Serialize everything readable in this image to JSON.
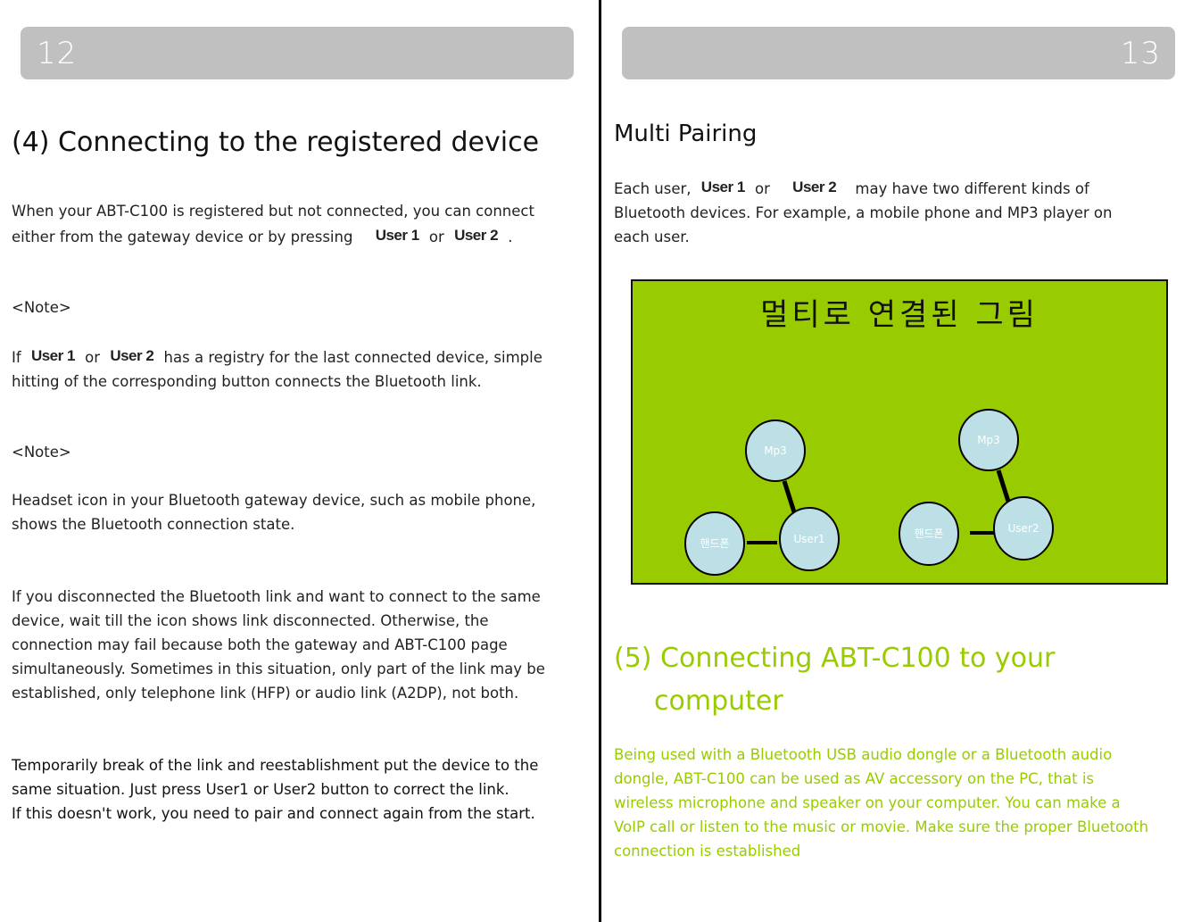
{
  "left_page": {
    "page_number": "12",
    "heading": "(4) Connecting to the registered device",
    "intro": {
      "text_before": "When your ABT-C100 is registered but not connected, you can connect",
      "text_line2": "either from the gateway device or by pressing",
      "badge1": "User 1",
      "or": "or",
      "badge2": "User 2",
      "end": "."
    },
    "note1_label": "<Note>",
    "note1": {
      "prefix": "If",
      "badge1": "User 1",
      "or": "or",
      "badge2": "User 2",
      "text_line1": "has a registry for the last connected device, simple",
      "text_line2": "hitting of the corresponding button connects the Bluetooth link."
    },
    "note2_label": "<Note>",
    "note2_lines": [
      "Headset icon in your Bluetooth gateway device, such as mobile phone,",
      "shows the Bluetooth connection state."
    ],
    "disconnect_lines": [
      "If you disconnected the Bluetooth link and want to connect to the same",
      "device, wait till the icon shows link disconnected. Otherwise, the",
      "connection may fail because both the gateway and ABT-C100 page",
      "simultaneously. Sometimes in this situation, only part of the link may be",
      "established, only telephone link (HFP) or audio link (A2DP), not both."
    ],
    "temporary_lines": [
      "Temporarily break of the link and reestablishment put the device to the",
      "same situation. Just press User1 or User2 button to correct the link.",
      "If this doesn't work, you need to pair and connect again from the start."
    ]
  },
  "right_page": {
    "page_number": "13",
    "heading": "Multi Pairing",
    "intro": {
      "prefix": "Each user,",
      "badge1": "User 1",
      "or": "or",
      "badge2": "User 2",
      "text_line1": "may have two different kinds of",
      "text_line2": "Bluetooth devices. For example, a mobile phone and MP3 player on",
      "text_line3": "each user."
    },
    "diagram": {
      "title": "멀티로 연결된 그림",
      "background_color": "#99cc00",
      "node_color": "#bde0e6",
      "groups": [
        {
          "user": "User1",
          "devices": [
            "Mp3",
            "핸드폰"
          ]
        },
        {
          "user": "User2",
          "devices": [
            "Mp3",
            "핸드폰"
          ]
        }
      ]
    },
    "section5": {
      "heading_line1": "(5) Connecting ABT-C100 to your",
      "heading_line2": "computer",
      "accent_color": "#99cc00",
      "body_lines": [
        "Being used with a Bluetooth USB audio dongle or a Bluetooth audio",
        "dongle, ABT-C100 can be used as AV accessory on the PC, that is",
        "wireless microphone and speaker on your computer. You can make a",
        "VoIP call or listen to the music or movie. Make sure the proper Bluetooth",
        "connection is established"
      ]
    }
  }
}
